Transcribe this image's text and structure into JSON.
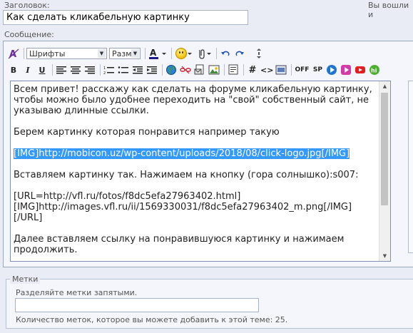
{
  "title_field": {
    "label": "Заголовок:",
    "value": "Как сделать кликабельную картинку"
  },
  "login_hint": "Вы вошли и",
  "message_label": "Сообщение:",
  "toolbar": {
    "font_select": "Шрифты",
    "size_select": "Разме",
    "bold": "B",
    "italic": "I",
    "underline": "U",
    "code": "<>",
    "off": "OFF",
    "sp": "SP",
    "hash": "#"
  },
  "message_text": {
    "before": "Всем привет! расскажу как сделать на форуме кликабельную картинку, чтобы можно было удобнее переходить на \"свой\" собственный сайт, не указываю длинные ссылки.\n\nБерем картинку которая понравится например такую\n\n",
    "selected": "[IMG]http://mobicon.uz/wp-content/uploads/2018/08/click-logo.jpg[/IMG]",
    "after": "\n\nВставляем картинку так. Нажимаем на кнопку (гора солнышко):s007:\n\n[URL=http://vfl.ru/fotos/f8dc5efa27963402.html]\n[IMG]http://images.vfl.ru/ii/1569330031/f8dc5efa27963402_m.png[/IMG]\n[/URL]\n\nДалее вставляем ссылку на понравившуюся картинку и нажимаем продолжить."
  },
  "tags": {
    "legend": "Метки",
    "hint": "Разделяйте метки запятыми.",
    "value": "",
    "count_text": "Количество меток, которое вы можете добавить к этой теме: 25."
  }
}
